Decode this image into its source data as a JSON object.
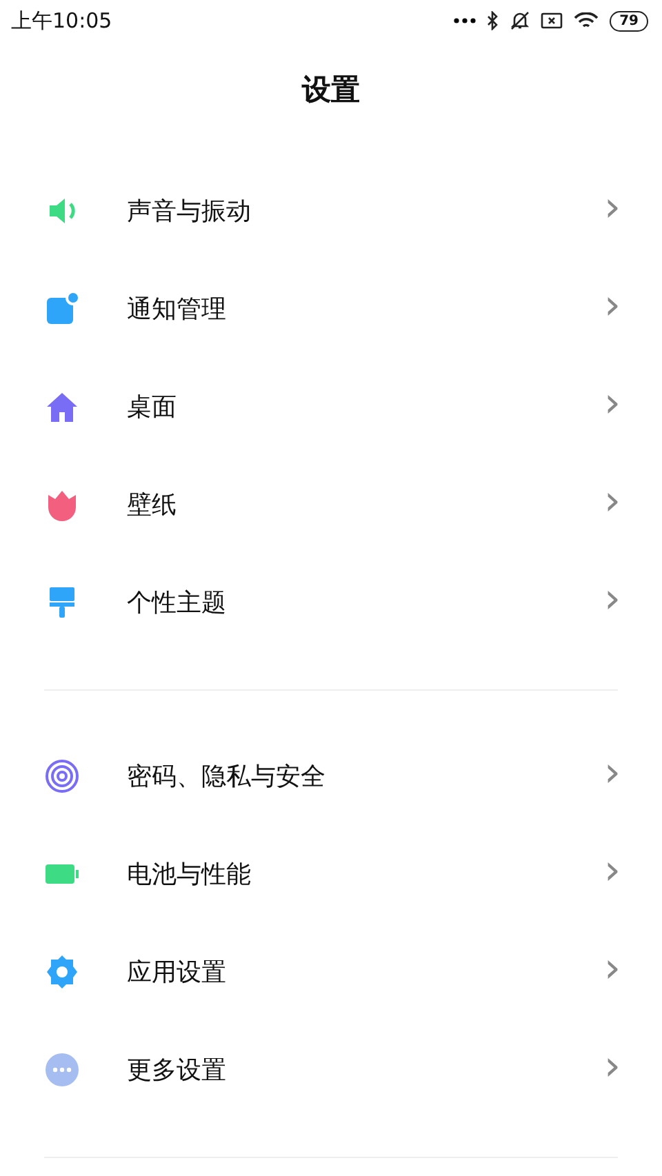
{
  "status_bar": {
    "time": "上午10:05",
    "battery": "79"
  },
  "title": "设置",
  "sections": [
    {
      "items": [
        {
          "label": "声音与振动",
          "chevron": "›"
        },
        {
          "label": "通知管理",
          "chevron": "›"
        },
        {
          "label": "桌面",
          "chevron": "›"
        },
        {
          "label": "壁纸",
          "chevron": "›"
        },
        {
          "label": "个性主题",
          "chevron": "›"
        }
      ]
    },
    {
      "items": [
        {
          "label": "密码、隐私与安全",
          "chevron": "›"
        },
        {
          "label": "电池与性能",
          "chevron": "›"
        },
        {
          "label": "应用设置",
          "chevron": "›"
        },
        {
          "label": "更多设置",
          "chevron": "›"
        }
      ]
    }
  ]
}
